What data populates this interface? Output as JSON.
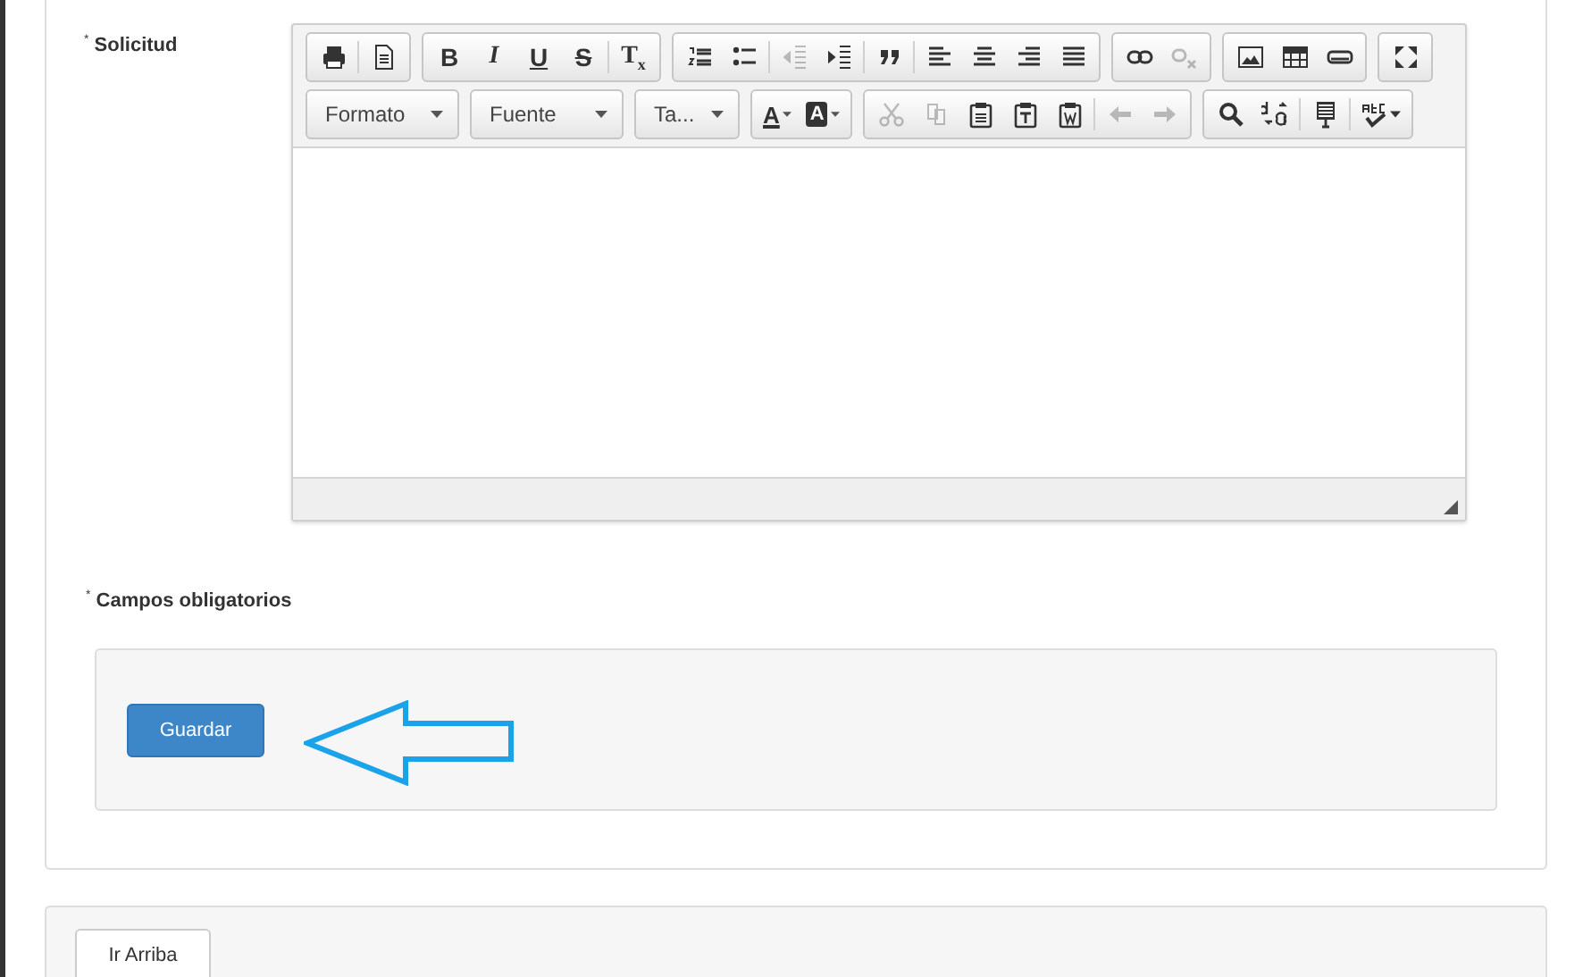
{
  "form": {
    "field": {
      "required_mark": "*",
      "label": "Solicitud"
    },
    "editor": {
      "toolbar_rows": [
        [
          {
            "items": [
              {
                "kind": "icon",
                "disabled": false
              },
              {
                "kind": "icon",
                "disabled": false
              }
            ]
          },
          {
            "items": [
              {
                "kind": "letter",
                "label": "B",
                "disabled": false
              },
              {
                "kind": "letter",
                "label": "I",
                "disabled": false
              },
              {
                "kind": "letter",
                "label": "U",
                "disabled": false
              },
              {
                "kind": "letter",
                "label": "S",
                "disabled": false
              },
              {
                "kind": "letter",
                "label": "T$_{x}$",
                "disabled": false
              }
            ]
          },
          {
            "items": [
              {
                "kind": "icon",
                "disabled": false
              },
              {
                "kind": "icon",
                "disabled": false
              },
              {
                "kind": "icon",
                "disabled": true
              },
              {
                "kind": "icon",
                "disabled": false
              },
              {
                "kind": "icon",
                "disabled": false
              },
              {
                "kind": "icon",
                "disabled": false
              },
              {
                "kind": "icon",
                "disabled": false
              },
              {
                "kind": "icon",
                "disabled": false
              },
              {
                "kind": "icon",
                "disabled": false
              }
            ]
          },
          {
            "items": [
              {
                "kind": "icon",
                "disabled": false
              },
              {
                "kind": "icon",
                "disabled": true
              }
            ]
          },
          {
            "items": [
              {
                "kind": "icon",
                "disabled": false
              },
              {
                "kind": "icon",
                "disabled": false
              },
              {
                "kind": "icon",
                "disabled": false
              }
            ]
          },
          {
            "items": [
              {
                "kind": "icon",
                "disabled": false
              }
            ]
          }
        ],
        [
          {
            "items": [
              {
                "kind": "combo",
                "label": "Formato"
              }
            ]
          },
          {
            "items": [
              {
                "kind": "combo",
                "label": "Fuente"
              }
            ]
          },
          {
            "items": [
              {
                "kind": "combo",
                "label": "Ta..."
              }
            ]
          },
          {
            "items": [
              {
                "kind": "color",
                "label": "A"
              },
              {
                "kind": "color",
                "label": "A"
              }
            ]
          },
          {
            "items": [
              {
                "kind": "icon",
                "disabled": true
              },
              {
                "kind": "icon",
                "disabled": true
              },
              {
                "kind": "icon",
                "disabled": false
              },
              {
                "kind": "icon",
                "disabled": false
              },
              {
                "kind": "icon",
                "disabled": false
              },
              {
                "kind": "icon",
                "disabled": true
              },
              {
                "kind": "icon",
                "disabled": true
              }
            ]
          },
          {
            "items": [
              {
                "kind": "icon",
                "disabled": false
              },
              {
                "kind": "icon",
                "disabled": false
              },
              {
                "kind": "icon",
                "disabled": false
              },
              {
                "kind": "icon",
                "disabled": false
              }
            ]
          }
        ]
      ]
    },
    "note": {
      "required_mark": "*",
      "text": "Campos obligatorios"
    },
    "actions": {
      "save_button": {
        "label": "Guardar"
      },
      "annotation": {
        "kind": "arrow"
      }
    }
  },
  "footer": {
    "top_button": {
      "label": "Ir Arriba"
    }
  }
}
